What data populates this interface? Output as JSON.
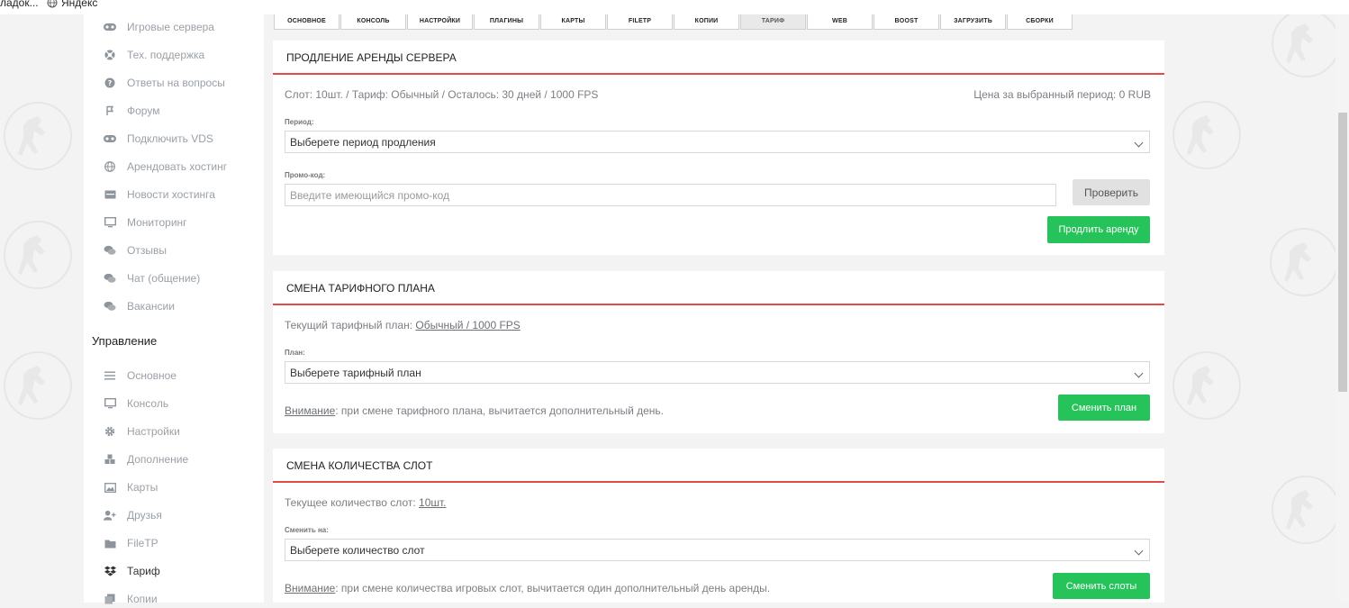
{
  "bookmarks": {
    "item1": "ладок...",
    "item2": "Яндекс"
  },
  "sidebar": {
    "items_top": [
      {
        "label": "Игровые сервера",
        "icon": "gamepad-icon"
      },
      {
        "label": "Тех. поддержка",
        "icon": "lifebuoy-icon"
      },
      {
        "label": "Ответы на вопросы",
        "icon": "question-icon"
      },
      {
        "label": "Форум",
        "icon": "flag-icon"
      },
      {
        "label": "Подключить VDS",
        "icon": "gamepad-icon"
      },
      {
        "label": "Арендовать хостинг",
        "icon": "globe-icon"
      },
      {
        "label": "Новости хостинга",
        "icon": "card-icon"
      },
      {
        "label": "Мониторинг",
        "icon": "monitor-icon"
      },
      {
        "label": "Отзывы",
        "icon": "comments-icon"
      },
      {
        "label": "Чат (общение)",
        "icon": "comments-icon"
      },
      {
        "label": "Вакансии",
        "icon": "comments-icon"
      }
    ],
    "section_title": "Управление",
    "items_manage": [
      {
        "label": "Основное",
        "icon": "menu-icon"
      },
      {
        "label": "Консоль",
        "icon": "monitor-icon"
      },
      {
        "label": "Настройки",
        "icon": "gear-icon"
      },
      {
        "label": "Дополнение",
        "icon": "cubes-icon"
      },
      {
        "label": "Карты",
        "icon": "image-icon"
      },
      {
        "label": "Друзья",
        "icon": "user-plus-icon"
      },
      {
        "label": "FileTP",
        "icon": "folder-icon"
      },
      {
        "label": "Тариф",
        "icon": "dropbox-icon"
      },
      {
        "label": "Копии",
        "icon": "copy-icon"
      }
    ],
    "active": "Тариф"
  },
  "tabs": [
    "ОСНОВНОЕ",
    "КОНСОЛЬ",
    "НАСТРОЙКИ",
    "ПЛАГИНЫ",
    "КАРТЫ",
    "FILETP",
    "КОПИИ",
    "ТАРИФ",
    "WEB",
    "BOOST",
    "ЗАГРУЗИТЬ",
    "СБОРКИ"
  ],
  "active_tab": "ТАРИФ",
  "renewal": {
    "title": "ПРОДЛЕНИЕ АРЕНДЫ СЕРВЕРА",
    "info": "Слот: 10шт. / Тариф: Обычный / Осталось: 30 дней / 1000 FPS",
    "price": "Цена за выбранный период: 0 RUB",
    "period_label": "Период:",
    "period_value": "Выберете период продления",
    "promo_label": "Промо-код:",
    "promo_placeholder": "Введите имеющийся промо-код",
    "check_button": "Проверить",
    "submit_button": "Продлить аренду"
  },
  "plan": {
    "title": "СМЕНА ТАРИФНОГО ПЛАНА",
    "current_prefix": "Текущий тарифный план:",
    "current_value": "Обычный / 1000 FPS",
    "plan_label": "План:",
    "plan_value": "Выберете тарифный план",
    "warning_word": "Внимание",
    "warning_text": ": при смене тарифного плана, вычитается дополнительный день.",
    "submit_button": "Сменить план"
  },
  "slots": {
    "title": "СМЕНА КОЛИЧЕСТВА СЛОТ",
    "current_prefix": "Текущее количество слот:",
    "current_value": "10шт.",
    "change_label": "Сменить на:",
    "change_value": "Выберете количество слот",
    "warning_word": "Внимание",
    "warning_text": ": при смене количества игровых слот, вычитается один дополнительный день аренды.",
    "submit_button": "Сменить слоты"
  },
  "colors": {
    "accent_red": "#e04b4b",
    "accent_green": "#25c35a"
  }
}
